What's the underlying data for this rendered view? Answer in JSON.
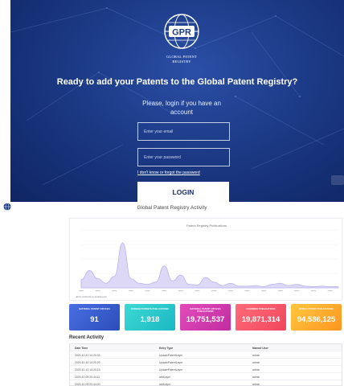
{
  "login": {
    "logo_text": "GPR",
    "org_name_line1": "GLOBAL PATENT",
    "org_name_line2": "REGISTRY",
    "headline": "Ready to add your Patents to the Global Patent Registry?",
    "subtext": "Please, login if you have an account",
    "email_placeholder": "Enter your email",
    "password_placeholder": "Enter your password",
    "forgot_link": "I don't know or forgot the password",
    "login_button": "LOGIN"
  },
  "dashboard": {
    "title": "Global Patent Registry Activity",
    "chart_data": {
      "type": "area",
      "title": "Patent Registry Publications",
      "series": [
        {
          "values": [
            14,
            30,
            16,
            8,
            20,
            78,
            16,
            8,
            6,
            10,
            38,
            12,
            22,
            6,
            5,
            18,
            10,
            4,
            8,
            3,
            3,
            4,
            2,
            6,
            8,
            4,
            6,
            3,
            2,
            3,
            2,
            2
          ]
        }
      ],
      "ylim": [
        0,
        100
      ],
      "colors": [
        "#b8b2ee"
      ],
      "legend_note": "■ the publications database by"
    },
    "stats": [
      {
        "label": "NATIONAL PATENT OFFICES",
        "value": "91"
      },
      {
        "label": "FOREIGN PATENTS PUBLICATIONS",
        "value": "1,918"
      },
      {
        "label": "NATIONAL PATENT OFFICES PUBLICATIONS",
        "value": "19,751,537"
      },
      {
        "label": "COMBINED PUBLICATIONS",
        "value": "19,871,314"
      },
      {
        "label": "WORLD PATENT PUBLICATIONS",
        "value": "94,586,125"
      }
    ],
    "recent": {
      "title": "Recent Activity",
      "columns": [
        "Date Time",
        "Entry Type",
        "Named User"
      ],
      "rows": [
        [
          "2020-10-10 14:20:33",
          "UpdatePatentLayer",
          "admin"
        ],
        [
          "2020-10-10 14:20:29",
          "UpdatePatentLayer",
          "admin"
        ],
        [
          "2020-10-10 14:20:15",
          "UpdatePatentLayer",
          "admin"
        ],
        [
          "2020-10-09 20:44:11",
          "addLayer",
          "admin"
        ],
        [
          "2020-10-09 20:44:00",
          "addLayer",
          "admin"
        ]
      ]
    }
  }
}
